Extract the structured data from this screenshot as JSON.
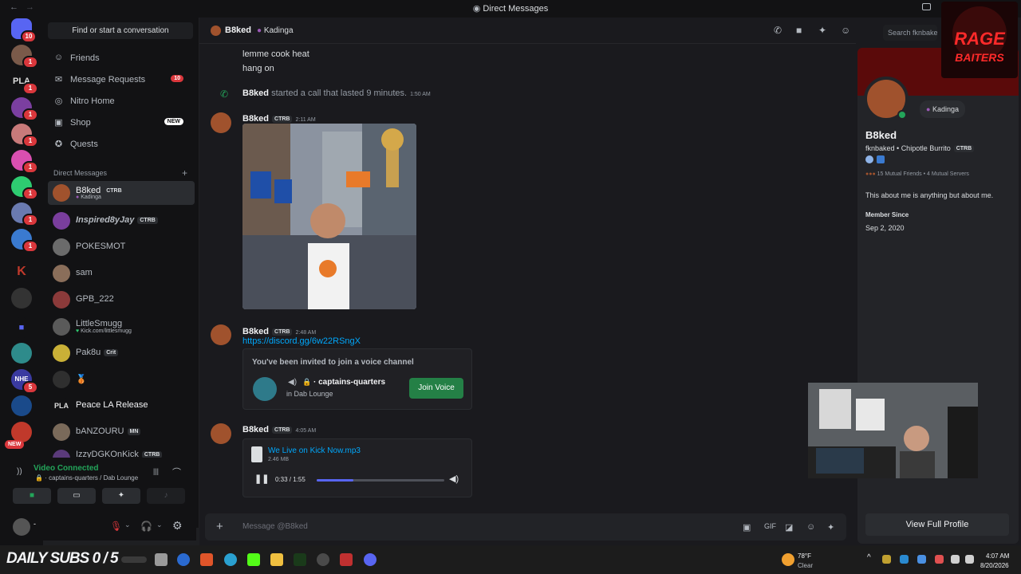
{
  "window": {
    "title": "Direct Messages"
  },
  "server_badges": [
    "10",
    "1",
    "1",
    "1",
    "1",
    "1",
    "1",
    "1",
    "1",
    "1",
    "5"
  ],
  "server_new": "NEW",
  "sidebar": {
    "search_placeholder": "Find or start a conversation",
    "nav": [
      {
        "label": "Friends",
        "icon": "friends-icon"
      },
      {
        "label": "Message Requests",
        "icon": "mail-icon",
        "badge": "10"
      },
      {
        "label": "Nitro Home",
        "icon": "nitro-icon"
      },
      {
        "label": "Shop",
        "icon": "shop-icon",
        "badge": "NEW"
      },
      {
        "label": "Quests",
        "icon": "quests-icon"
      }
    ],
    "dm_header": "Direct Messages",
    "dm_add": "+",
    "dms": [
      {
        "name": "B8ked",
        "tag": "CTRB",
        "sub": "Kadinga",
        "color": "#a0522d"
      },
      {
        "name": "Inspired8yJay",
        "tag": "CTRB",
        "color": "#7a3e9d"
      },
      {
        "name": "POKESMOT",
        "color": "#6b6b6b"
      },
      {
        "name": "sam",
        "color": "#8a6e5a"
      },
      {
        "name": "GPB_222",
        "color": "#8b3a3a"
      },
      {
        "name": "LittleSmugg",
        "sub": "Kick.com/littlesmugg",
        "color": "#5a5a5a"
      },
      {
        "name": "Pak8u",
        "tag": "Crit",
        "color": "#c9b037"
      },
      {
        "name": "🥉",
        "color": "#2f2f2f"
      },
      {
        "name": "Peace LA Release",
        "color": "#3a3a3a"
      },
      {
        "name": "bANZOURU",
        "tag": "MN",
        "color": "#7a6a5a"
      },
      {
        "name": "IzzyDGKOnKick",
        "tag": "CTRB",
        "color": "#5a3a7a"
      }
    ]
  },
  "voice": {
    "status": "Video Connected",
    "channel": "· captains-quarters / Dab Lounge"
  },
  "user": {
    "name": "-"
  },
  "chat": {
    "header_name": "B8ked",
    "header_sub": "Kadinga",
    "search_placeholder": "Search fknbaked",
    "lines": [
      "lemme cook heat",
      "hang on"
    ],
    "call": {
      "user": "B8ked",
      "text": "started a call that lasted 9 minutes.",
      "time": "1:50 AM"
    },
    "messages": [
      {
        "user": "B8ked",
        "tag": "CTRB",
        "time": "2:11 AM"
      },
      {
        "user": "B8ked",
        "tag": "CTRB",
        "time": "2:48 AM",
        "link": "https://discord.gg/6w22RSngX"
      },
      {
        "user": "B8ked",
        "tag": "CTRB",
        "time": "4:05 AM"
      }
    ],
    "invite": {
      "title": "You've been invited to join a voice channel",
      "channel": "· captains-quarters",
      "server": "in Dab Lounge",
      "button": "Join Voice"
    },
    "file": {
      "name": "We Live on Kick Now.mp3",
      "size": "2.46 MB",
      "time": "0:33 / 1:55",
      "progress": 0.29
    },
    "composer_placeholder": "Message @B8ked"
  },
  "profile": {
    "display_name": "B8ked",
    "username": "fknbaked",
    "status": "Chipotle Burrito",
    "tag": "CTRB",
    "activity": "Kadinga",
    "mutual_friends": "15 Mutual Friends",
    "mutual_servers": "4 Mutual Servers",
    "bio": "This about me is anything but about me.",
    "member_since_label": "Member Since",
    "member_since": "Sep 2, 2020",
    "view_button": "View Full Profile",
    "banner_color": "#5a0a0a"
  },
  "overlay": {
    "line1": "RAGE",
    "line2": "BAITERS"
  },
  "taskbar": {
    "subs": "DAILY SUBS 0 / 5",
    "weather_temp": "78°F",
    "weather_text": "Clear",
    "time": "4:07 AM",
    "date": "8/20/2026"
  }
}
